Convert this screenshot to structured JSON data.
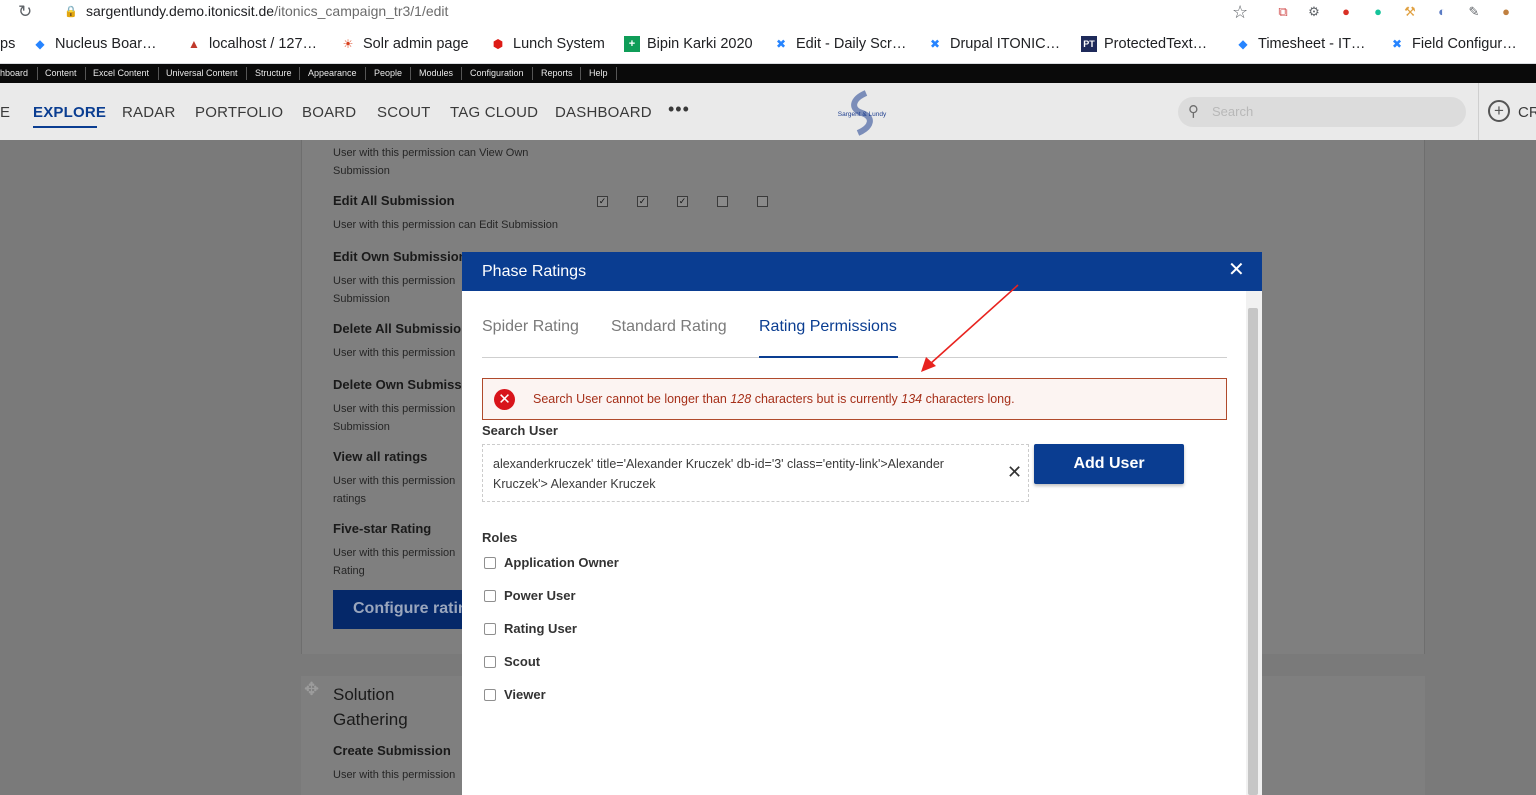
{
  "browser": {
    "url_host": "sargentlundy.demo.itonicsit.de",
    "url_path": "/itonics_campaign_tr3/1/edit",
    "bookmarks": [
      {
        "label": "ps"
      },
      {
        "label": "Nucleus Boar…"
      },
      {
        "label": "localhost / 127…"
      },
      {
        "label": "Solr admin page"
      },
      {
        "label": "Lunch System"
      },
      {
        "label": "Bipin Karki 2020"
      },
      {
        "label": "Edit - Daily Scr…"
      },
      {
        "label": "Drupal ITONIC…"
      },
      {
        "label": "ProtectedText…"
      },
      {
        "label": "Timesheet - IT…"
      },
      {
        "label": "Field Configur…"
      }
    ]
  },
  "admin_toolbar": {
    "items": [
      "hboard",
      "Content",
      "Excel Content",
      "Universal Content",
      "Structure",
      "Appearance",
      "People",
      "Modules",
      "Configuration",
      "Reports",
      "Help"
    ]
  },
  "app_nav": {
    "items": [
      "E",
      "EXPLORE",
      "RADAR",
      "PORTFOLIO",
      "BOARD",
      "SCOUT",
      "TAG CLOUD",
      "DASHBOARD"
    ],
    "more": "•••",
    "logo_text": "Sargent & Lundy",
    "search_placeholder": "Search",
    "create_label": "CR"
  },
  "background": {
    "permissions": [
      {
        "desc": "User with this permission can View Own Submission"
      },
      {
        "title": "Edit All Submission",
        "desc": "User with this permission can Edit Submission"
      },
      {
        "title": "Edit Own Submission",
        "desc": "User with this permission Submission"
      },
      {
        "title": "Delete All Submission",
        "desc": "User with this permission"
      },
      {
        "title": "Delete Own Submission",
        "desc": "User with this permission Submission"
      },
      {
        "title": "View all ratings",
        "desc": "User with this permission ratings"
      },
      {
        "title": "Five-star Rating",
        "desc": "User with this permission Rating"
      }
    ],
    "configure_button": "Configure ratin",
    "solution_title": "Solution Gathering",
    "create_submission": "Create Submission",
    "create_submission_desc": "User with this permission"
  },
  "modal": {
    "title": "Phase Ratings",
    "tabs": [
      "Spider Rating",
      "Standard Rating",
      "Rating Permissions"
    ],
    "active_tab": "Rating Permissions",
    "alert": {
      "prefix": "Search User cannot be longer than ",
      "max": "128",
      "middle": " characters but is currently ",
      "current": "134",
      "suffix": " characters long."
    },
    "search_user_label": "Search User",
    "search_user_value": "alexanderkruczek' title='Alexander Kruczek' db-id='3' class='entity-link'>Alexander Kruczek'> Alexander Kruczek",
    "add_user_button": "Add User",
    "roles_label": "Roles",
    "roles": [
      "Application Owner",
      "Power User",
      "Rating User",
      "Scout",
      "Viewer"
    ]
  },
  "colors": {
    "primary": "#0a3d91",
    "error": "#d8141b",
    "arrow": "#e8231f"
  }
}
